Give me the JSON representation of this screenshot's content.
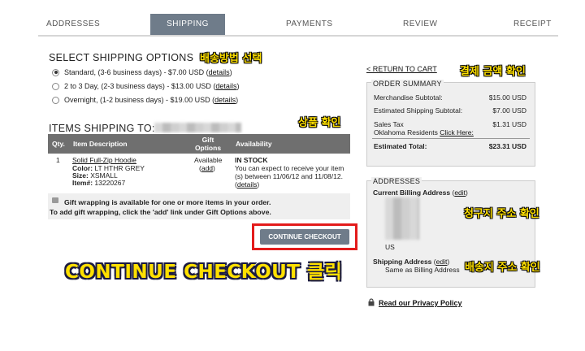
{
  "tabs": [
    {
      "label": "ADDRESSES"
    },
    {
      "label": "SHIPPING"
    },
    {
      "label": "PAYMENTS"
    },
    {
      "label": "REVIEW"
    },
    {
      "label": "RECEIPT"
    }
  ],
  "shipping": {
    "title": "SELECT SHIPPING OPTIONS",
    "annotation": "배송방법 선택",
    "options": [
      {
        "text": "Standard, (3-6 business days) - $7.00 USD (",
        "link": "details",
        "end": ")",
        "selected": true
      },
      {
        "text": "2 to 3 Day, (2-3 business days) - $13.00 USD (",
        "link": "details",
        "end": ")",
        "selected": false
      },
      {
        "text": "Overnight, (1-2 business days) - $19.00 USD (",
        "link": "details",
        "end": ")",
        "selected": false
      }
    ]
  },
  "items": {
    "title": "ITEMS SHIPPING TO:",
    "annotation": "상품 확인",
    "headers": {
      "qty": "Qty.",
      "desc": "Item Description",
      "gift": "Gift Options",
      "avail": "Availability"
    },
    "row": {
      "qty": "1",
      "name": "Solid Full-Zip Hoodie",
      "color_label": "Color:",
      "color": "LT HTHR GREY",
      "size_label": "Size:",
      "size": "XSMALL",
      "item_label": "Item#:",
      "item": "13220267",
      "gift_available": "Available",
      "gift_add": "add",
      "stock": "IN STOCK",
      "stock_note": "You can expect to receive your item (s) between 11/06/12 and 11/08/12.",
      "details": "details"
    }
  },
  "gift_note": {
    "line1": "Gift wrapping is available for one or more items in your order.",
    "line2": "To add gift wrapping, click the 'add' link under Gift Options above."
  },
  "continue_button": "CONTINUE CHECKOUT",
  "continue_caption": "CONTINUE CHECKOUT 클릭",
  "sidebar": {
    "return_link": "< RETURN TO CART",
    "annotation_total": "결제 금액 확인",
    "summary_title": "ORDER SUMMARY",
    "rows": [
      {
        "label": "Merchandise Subtotal:",
        "value": "$15.00 USD"
      },
      {
        "label": "Estimated Shipping Subtotal:",
        "value": "$7.00 USD"
      },
      {
        "label": "Sales Tax",
        "value": "$1.31 USD"
      }
    ],
    "tax_note": "Oklahoma Residents",
    "tax_link": "Click Here:",
    "total_label": "Estimated Total:",
    "total_value": "$23.31 USD",
    "addresses_title": "ADDRESSES",
    "billing_label": "Current Billing Address",
    "billing_edit": "edit",
    "billing_country": "US",
    "annotation_billing": "청구지 주소 확인",
    "shipping_label": "Shipping Address",
    "shipping_edit": "edit",
    "shipping_note": "Same as Billing Address",
    "annotation_shipping": "배송지 주소 확인",
    "privacy": "Read our Privacy Policy"
  },
  "colors": {
    "tab_active": "#6f7c8a",
    "highlight": "#e31b1b",
    "annotation": "#ffe000"
  }
}
